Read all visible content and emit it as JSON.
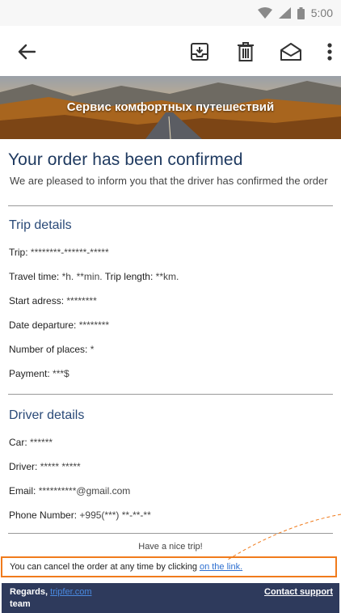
{
  "status_bar": {
    "time": "5:00"
  },
  "toolbar": {
    "back_icon": "arrow-left-icon",
    "archive_icon": "archive-icon",
    "delete_icon": "trash-icon",
    "mail_icon": "envelope-open-icon",
    "more_icon": "more-vert-icon"
  },
  "banner": {
    "title": "Сервис комфортных путешествий"
  },
  "email": {
    "heading": "Your order has been confirmed",
    "intro": "We are pleased to inform you that the driver has confirmed the order",
    "trip": {
      "title": "Trip details",
      "trip_label": "Trip:",
      "trip_value": "********-******-*****",
      "travel_time_label": "Travel time:",
      "travel_time_value": "*h. **min.",
      "trip_length_label": "Trip length:",
      "trip_length_value": "**km.",
      "start_label": "Start adress:",
      "start_value": "********",
      "date_label": "Date departure:",
      "date_value": "********",
      "places_label": "Number of places:",
      "places_value": "*",
      "payment_label": "Payment:",
      "payment_value": "***$"
    },
    "driver": {
      "title": "Driver details",
      "car_label": "Car:",
      "car_value": "******",
      "driver_label": "Driver:",
      "driver_value": "***** *****",
      "email_label": "Email:",
      "email_value": "**********@gmail.com",
      "phone_label": "Phone Number:",
      "phone_value": "+995(***) **-**-**"
    },
    "nice_trip": "Have a nice trip!",
    "cancel_text": "You can cancel the order at any time by clicking",
    "cancel_link": "on the link.",
    "footer": {
      "regards": "Regards,",
      "brand_link": "tripfer.com",
      "team": "team",
      "support": "Contact support"
    }
  },
  "colors": {
    "highlight_border": "#f07b1c",
    "footer_bg": "#2e3a5c",
    "link": "#2d6fd0"
  }
}
